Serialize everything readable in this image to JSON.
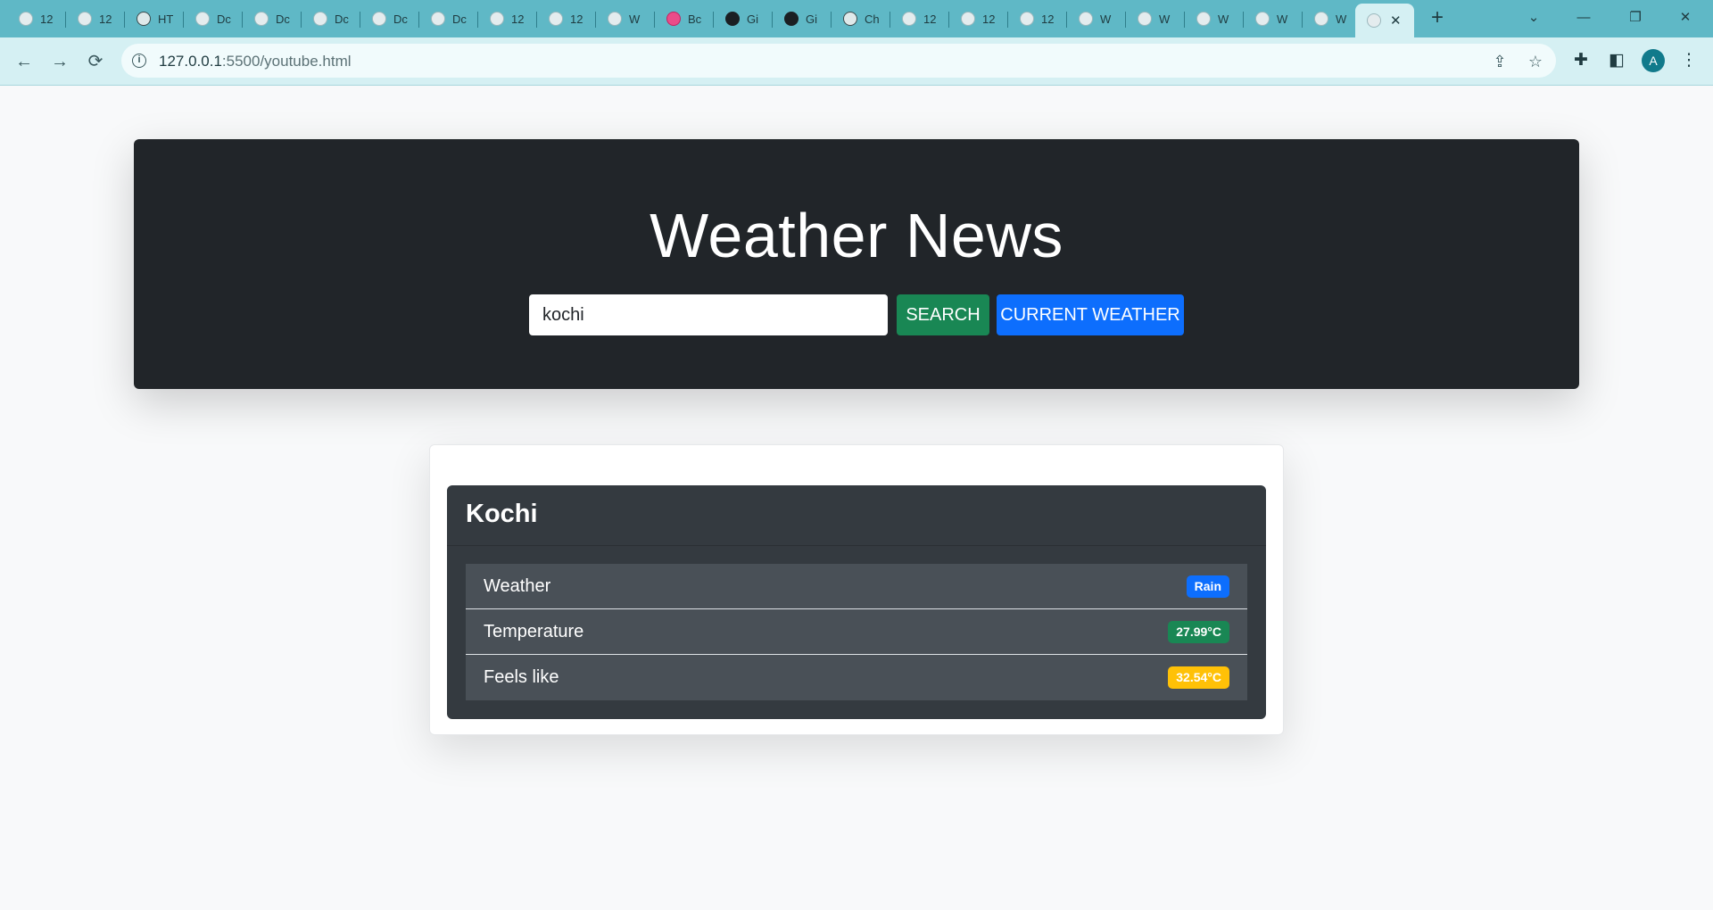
{
  "browser": {
    "tabs": [
      {
        "title": "12",
        "icon": "generic-globe-icon"
      },
      {
        "title": "12",
        "icon": "generic-globe-icon"
      },
      {
        "title": "HT",
        "icon": "chatgpt-icon"
      },
      {
        "title": "Dc",
        "icon": "generic-globe-icon"
      },
      {
        "title": "Dc",
        "icon": "generic-globe-icon"
      },
      {
        "title": "Dc",
        "icon": "generic-globe-icon"
      },
      {
        "title": "Dc",
        "icon": "generic-globe-icon"
      },
      {
        "title": "Dc",
        "icon": "generic-globe-icon"
      },
      {
        "title": "12",
        "icon": "generic-globe-icon"
      },
      {
        "title": "12",
        "icon": "generic-globe-icon"
      },
      {
        "title": "W",
        "icon": "generic-globe-icon"
      },
      {
        "title": "Bc",
        "icon": "dribbble-icon"
      },
      {
        "title": "Gi",
        "icon": "github-icon"
      },
      {
        "title": "Gi",
        "icon": "github-icon"
      },
      {
        "title": "Ch",
        "icon": "chatgpt-icon"
      },
      {
        "title": "12",
        "icon": "generic-globe-icon"
      },
      {
        "title": "12",
        "icon": "generic-globe-icon"
      },
      {
        "title": "12",
        "icon": "generic-globe-icon"
      },
      {
        "title": "W",
        "icon": "generic-globe-icon"
      },
      {
        "title": "W",
        "icon": "generic-globe-icon"
      },
      {
        "title": "W",
        "icon": "generic-globe-icon"
      },
      {
        "title": "W",
        "icon": "generic-globe-icon"
      },
      {
        "title": "W",
        "icon": "generic-globe-icon"
      }
    ],
    "active_tab": {
      "icon": "globe-icon",
      "close_glyph": "✕"
    },
    "new_tab_glyph": "+",
    "window_controls": {
      "tab_search": "⌄",
      "minimize": "—",
      "restore": "❐",
      "close": "✕"
    },
    "nav": {
      "back": "←",
      "forward": "→",
      "reload": "⟳"
    },
    "address": {
      "host": "127.0.0.1",
      "rest": ":5500/youtube.html"
    },
    "info_glyph": "i",
    "profile_initial": "A",
    "colors": {
      "tabstrip": "#5fb8c6",
      "toolbar": "#d5f0f3"
    }
  },
  "page": {
    "heading": "Weather News",
    "search": {
      "value": "kochi"
    },
    "buttons": {
      "search": "SEARCH",
      "current_weather": "CURRENT WEATHER"
    },
    "city_card": {
      "city": "Kochi",
      "rows": [
        {
          "label": "Weather",
          "value": "Rain",
          "color": "#0d6efd"
        },
        {
          "label": "Temperature",
          "value": "27.99°C",
          "color": "#198754"
        },
        {
          "label": "Feels like",
          "value": "32.54°C",
          "color": "#ffc107"
        }
      ]
    },
    "colors": {
      "hero_bg": "#212529",
      "search_btn": "#198754",
      "current_btn": "#0d6efd",
      "card_bg": "#343a40",
      "row_bg": "#495057"
    }
  }
}
